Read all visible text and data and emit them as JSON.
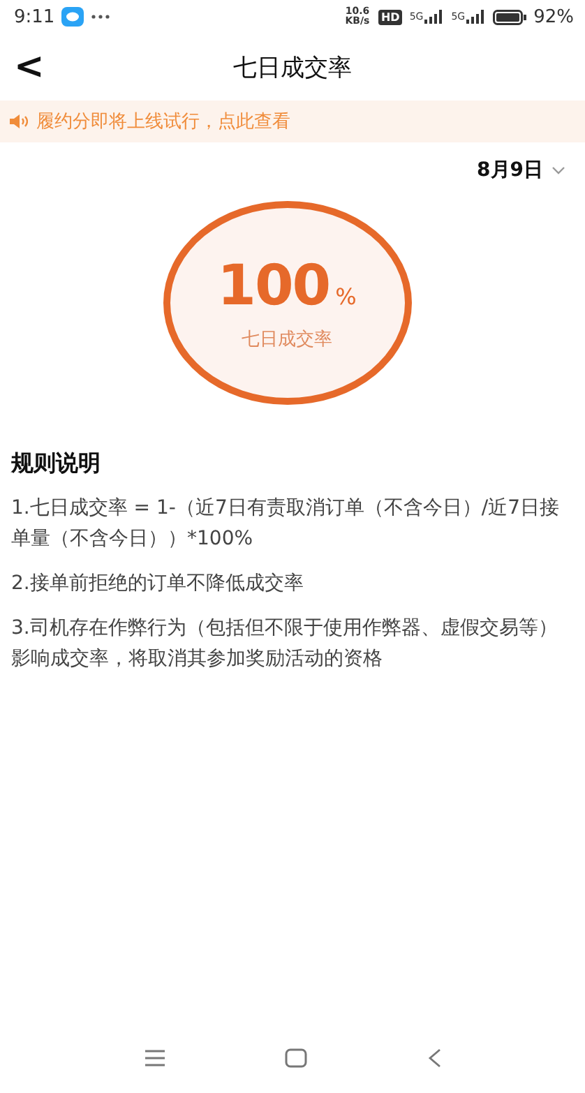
{
  "status_bar": {
    "time": "9:11",
    "net_speed": "10.6 KB/s",
    "hd": "HD",
    "signal_labels": [
      "5G",
      "5G"
    ],
    "battery": "92%"
  },
  "header": {
    "back": "<",
    "title": "七日成交率"
  },
  "notice": {
    "text": "履约分即将上线试行，点此查看"
  },
  "date_picker": {
    "value": "8月9日"
  },
  "rate": {
    "value": "100",
    "unit": "%",
    "label": "七日成交率"
  },
  "rules": {
    "title": "规则说明",
    "items": [
      "1.七日成交率 = 1-（近7日有责取消订单（不含今日）/近7日接单量（不含今日））*100%",
      "2.接单前拒绝的订单不降低成交率",
      "3.司机存在作弊行为（包括但不限于使用作弊器、虚假交易等）影响成交率，将取消其参加奖励活动的资格"
    ]
  }
}
